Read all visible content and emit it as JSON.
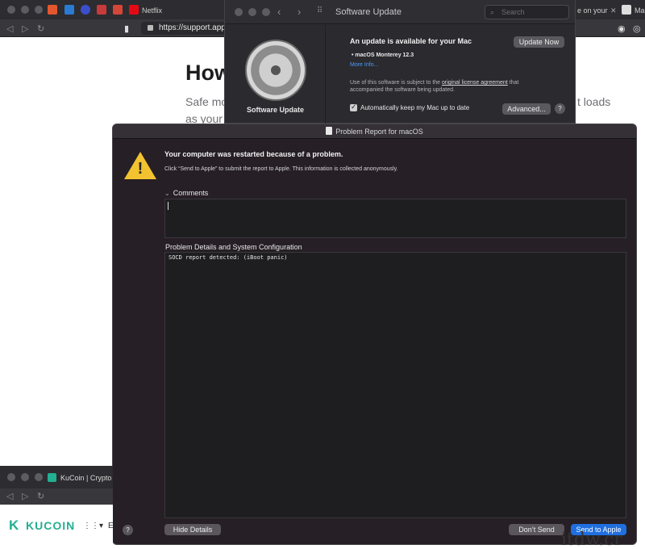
{
  "background_browser": {
    "tabs": [
      {
        "label": "Netflix",
        "icon": "netflix-icon"
      }
    ],
    "partial_tab_text": "e on your",
    "partial_tab_text2": "Ma",
    "url": "https://support.apple",
    "page": {
      "heading": "How",
      "line1": "Safe mo",
      "line2": "as your",
      "line1_right": "t loads"
    }
  },
  "software_update": {
    "title": "Software Update",
    "search_placeholder": "Search",
    "sidebar_label": "Software Update",
    "headline": "An update is available for your Mac",
    "update_button": "Update Now",
    "update_item": "• macOS Monterey 12.3",
    "more_info": "More Info...",
    "legal_text_1": "Use of this software is subject to the",
    "legal_link": "original license agreement",
    "legal_text_2": "that accompanied the software being updated.",
    "auto_update_label": "Automatically keep my Mac up to date",
    "auto_update_checked": true,
    "advanced_button": "Advanced...",
    "help": "?"
  },
  "problem_report": {
    "title": "Problem Report for macOS",
    "headline": "Your computer was restarted because of a problem.",
    "subtext": "Click “Send to Apple” to submit the report to Apple. This information is collected anonymously.",
    "comments_label": "Comments",
    "details_label": "Problem Details and System Configuration",
    "details_text": "SOCD report detected: (iBoot panic)",
    "help": "?",
    "hide_details_button": "Hide Details",
    "dont_send_button": "Don’t Send",
    "send_button": "Send to Apple"
  },
  "kucoin_browser": {
    "tab_label": "KuCoin | Crypto",
    "logo_text": "KUCOIN",
    "logo_mark": "K",
    "grid_icon": "⋮⋮▾",
    "menu_partial": "E"
  },
  "watermark": "itdw.cr",
  "colors": {
    "accent": "#1f6fe0",
    "warning": "#f2c230",
    "kucoin": "#23af91"
  }
}
